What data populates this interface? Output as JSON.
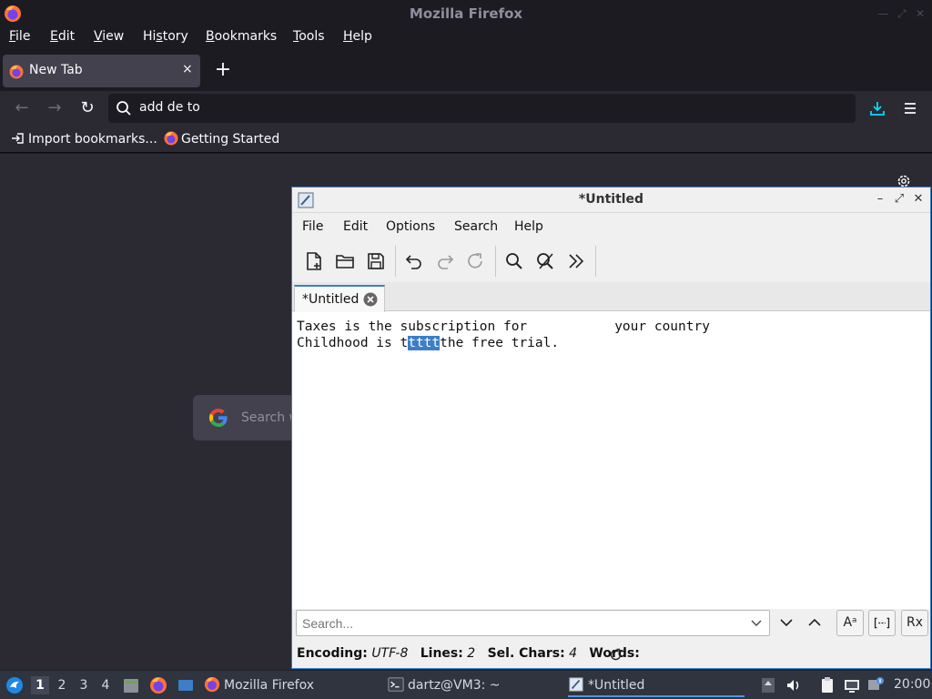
{
  "firefox": {
    "window_title": "Mozilla Firefox",
    "menu": [
      {
        "pre": "",
        "ul": "F",
        "post": "ile"
      },
      {
        "pre": "",
        "ul": "E",
        "post": "dit"
      },
      {
        "pre": "",
        "ul": "V",
        "post": "iew"
      },
      {
        "pre": "Hi",
        "ul": "s",
        "post": "tory"
      },
      {
        "pre": "",
        "ul": "B",
        "post": "ookmarks"
      },
      {
        "pre": "",
        "ul": "T",
        "post": "ools"
      },
      {
        "pre": "",
        "ul": "H",
        "post": "elp"
      }
    ],
    "tab": {
      "label": "New Tab",
      "close": "×"
    },
    "new_tab": "+",
    "url_text": "add de to",
    "bookmarks": [
      {
        "label": "Import bookmarks...",
        "icon": "import-icon"
      },
      {
        "label": "Getting Started",
        "icon": "firefox-icon"
      }
    ],
    "search_placeholder": "Search w",
    "colors": {
      "bg": "#1c1b22",
      "toolbar": "#2b2a33",
      "tab": "#42414d",
      "accent": "#00ddff"
    }
  },
  "mousepad": {
    "title": "*Untitled",
    "menu": [
      "File",
      "Edit",
      "Options",
      "Search",
      "Help"
    ],
    "toolbar_icons": [
      "new-document-icon",
      "open-icon",
      "save-icon",
      "undo-icon",
      "redo-icon",
      "reload-icon",
      "find-icon",
      "replace-icon",
      "more-icon"
    ],
    "tab_label": "*Untitled",
    "lines": [
      {
        "text": "Taxes is the subscription for           your country"
      },
      {
        "before": "Childhood is t",
        "selected": "tttt",
        "after": "the free trial."
      }
    ],
    "search": {
      "placeholder": "Search...",
      "match_case": "Aᵃ",
      "regex": "Rx"
    },
    "status": {
      "encoding_label": "Encoding:",
      "encoding": "UTF-8",
      "lines_label": "Lines:",
      "lines": "2",
      "sel_label": "Sel. Chars:",
      "sel": "4",
      "words_label": "Words:"
    },
    "colors": {
      "selection": "#3d7ec6",
      "chrome": "#f0f0f0"
    }
  },
  "taskbar": {
    "workspaces": [
      "1",
      "2",
      "3",
      "4"
    ],
    "tasks": [
      {
        "label": "Mozilla Firefox",
        "icon": "firefox-icon"
      },
      {
        "label": "dartz@VM3: ~",
        "icon": "terminal-icon"
      },
      {
        "label": "*Untitled",
        "icon": "mousepad-icon"
      }
    ],
    "clock": "20:00"
  }
}
